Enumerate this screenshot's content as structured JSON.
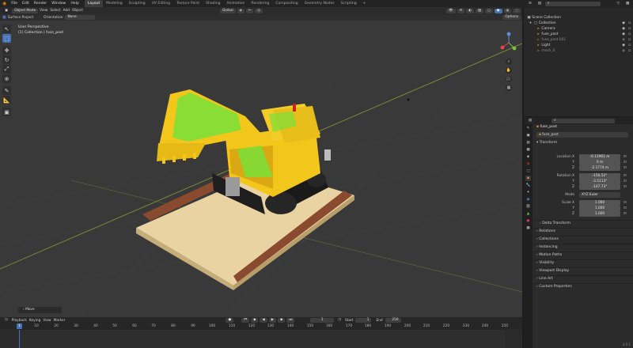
{
  "topbar": {
    "menu": [
      "File",
      "Edit",
      "Render",
      "Window",
      "Help"
    ],
    "tabs": [
      "Layout",
      "Modeling",
      "Sculpting",
      "UV Editing",
      "Texture Paint",
      "Shading",
      "Animation",
      "Rendering",
      "Compositing",
      "Geometry Nodes",
      "Scripting"
    ],
    "active_tab": "Layout",
    "scene": "Scene",
    "view_layer": "ViewLayer"
  },
  "viewport": {
    "mode": "Object Mode",
    "menus": [
      "View",
      "Select",
      "Add",
      "Object"
    ],
    "transform_orientation": "Global",
    "snap_label": "Surface Project",
    "orientation_label": "Orientation",
    "orientation_value": "None",
    "options_label": "Options",
    "info_line1": "User Perspective",
    "info_line2": "(1) Collection | fuse_post",
    "operator_panel": "Move"
  },
  "timeline": {
    "menus": [
      "Playback",
      "Keying",
      "View",
      "Marker"
    ],
    "current_frame": "1",
    "start_label": "Start",
    "start": "1",
    "end_label": "End",
    "end": "250",
    "ticks": [
      "1",
      "10",
      "20",
      "30",
      "40",
      "50",
      "60",
      "70",
      "80",
      "90",
      "100",
      "110",
      "120",
      "130",
      "140",
      "150",
      "160",
      "170",
      "180",
      "190",
      "200",
      "210",
      "220",
      "230",
      "240",
      "250"
    ],
    "version": "4.0.1"
  },
  "outliner": {
    "root": "Scene Collection",
    "collection": "Collection",
    "items": [
      "Camera",
      "fuse_post",
      "fuse_post.001",
      "Light",
      "mesh_0"
    ]
  },
  "properties": {
    "object_name": "fuse_post",
    "object_field": "fuse_post",
    "transform_header": "Transform",
    "location_label": "Location X",
    "location": [
      "-0.11961 m",
      "0 m",
      "-2.1774 m"
    ],
    "rotation_label": "Rotation X",
    "rotation": [
      "-156.52°",
      "-3.5113°",
      "-107.73°"
    ],
    "mode_label": "Mode",
    "mode_value": "XYZ Euler",
    "scale_label": "Scale X",
    "scale": [
      "1.000",
      "1.000",
      "1.000"
    ],
    "axis_y": "Y",
    "axis_z": "Z",
    "sections": [
      "Delta Transform",
      "Relations",
      "Collections",
      "Instancing",
      "Motion Paths",
      "Visibility",
      "Viewport Display",
      "Line Art",
      "Custom Properties"
    ]
  },
  "colors": {
    "accent": "#4772b3",
    "viewport_bg": "#393939",
    "panel_bg": "#2b2b2b",
    "model_yellow": "#f2c61a",
    "model_green": "#78e03a",
    "base_tan": "#e9d3a2",
    "brick_red": "#8a4a30"
  }
}
